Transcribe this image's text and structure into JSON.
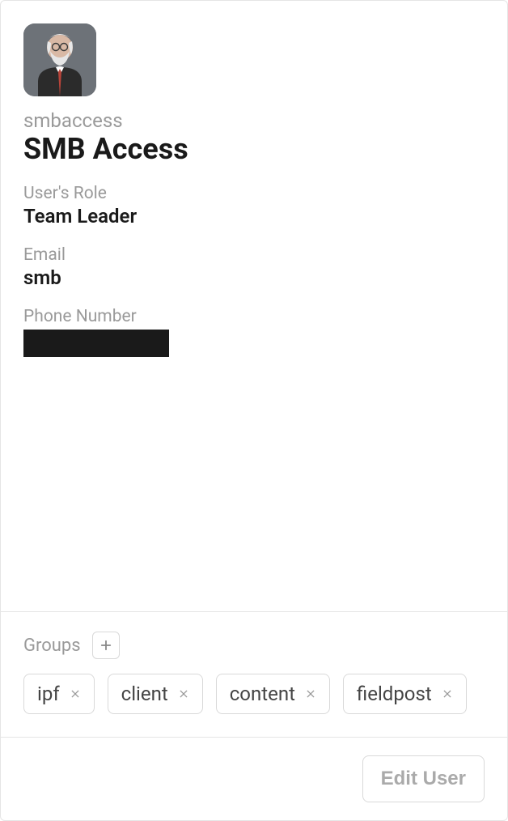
{
  "profile": {
    "username": "smbaccess",
    "display_name": "SMB Access",
    "role_label": "User's Role",
    "role_value": "Team Leader",
    "email_label": "Email",
    "email_value": "smb",
    "phone_label": "Phone Number"
  },
  "groups": {
    "label": "Groups",
    "items": [
      "ipf",
      "client",
      "content",
      "fieldpost"
    ]
  },
  "footer": {
    "edit_button": "Edit User"
  }
}
